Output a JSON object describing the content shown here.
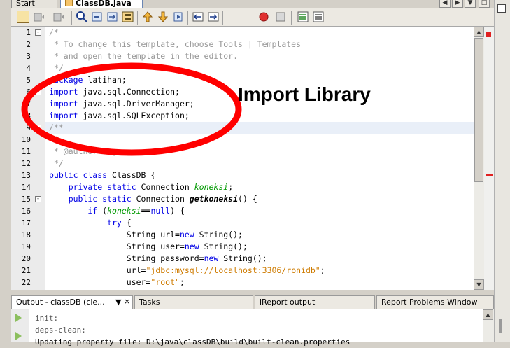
{
  "tabs": {
    "start_page": "Start Page",
    "active_tab": "ClassDB.java",
    "close_glyph": "×"
  },
  "toolbar": {
    "icons": [
      "new-file-icon",
      "history-back-icon",
      "history-forward-icon",
      "find-icon",
      "find-previous-icon",
      "find-next-icon",
      "toggle-highlight-icon",
      "previous-bookmark-icon",
      "next-bookmark-icon",
      "toggle-bookmark-icon",
      "shift-left-icon",
      "shift-right-icon",
      "start-macro-icon",
      "stop-macro-icon",
      "comment-icon",
      "uncomment-icon"
    ]
  },
  "editor": {
    "line_numbers": [
      "1",
      "2",
      "3",
      "4",
      "5",
      "6",
      "7",
      "8",
      "9",
      "10",
      "11",
      "12",
      "13",
      "14",
      "15",
      "16",
      "17",
      "18",
      "19",
      "20",
      "21",
      "22"
    ],
    "lines": {
      "l1": "/*",
      "l2": " * To change this template, choose Tools | Templates",
      "l3": " * and open the template in the editor.",
      "l4": " */",
      "l5_kw": "package",
      "l5_rest": " latihan;",
      "l6_kw": "import",
      "l6_rest": " java.sql.Connection;",
      "l7_kw": "import",
      "l7_rest": " java.sql.DriverManager;",
      "l8_kw": "import",
      "l8_rest": " java.sql.SQLException;",
      "l9": "/**",
      "l10": " *",
      "l11": " * @author bagong",
      "l12": " */",
      "l13_kw": "public class",
      "l13_rest": " ClassDB {",
      "l14_kw": "    private static",
      "l14_mid": " Connection ",
      "l14_fld": "koneksi",
      "l14_end": ";",
      "l15_kw": "    public static",
      "l15_mid": " Connection ",
      "l15_fn": "getkoneksi",
      "l15_end": "() {",
      "l16_kw": "        if",
      "l16_a": " (",
      "l16_fld": "koneksi",
      "l16_b": "==",
      "l16_null": "null",
      "l16_c": ") {",
      "l17_kw": "            try",
      "l17_rest": " {",
      "l18_a": "                String url=",
      "l18_kw": "new",
      "l18_b": " String();",
      "l19_a": "                String user=",
      "l19_kw": "new",
      "l19_b": " String();",
      "l20_a": "                String password=",
      "l20_kw": "new",
      "l20_b": " String();",
      "l21_a": "                url=",
      "l21_str": "\"jdbc:mysql://localhost:3306/ronidb\"",
      "l21_b": ";",
      "l22_a": "                user=",
      "l22_str": "\"root\"",
      "l22_b": ";"
    }
  },
  "annotation": {
    "text": "Import Library",
    "ellipse_color": "#ff0000"
  },
  "bottom_tabs": {
    "output": "Output - classDB (cle...",
    "tasks": "Tasks",
    "ireport": "iReport output",
    "report_problems": "Report Problems Window"
  },
  "output_lines": [
    "init:",
    "deps-clean:",
    "Updating property file: D:\\java\\classDB\\build\\built-clean.properties"
  ],
  "colors": {
    "keyword": "#0000e6",
    "comment": "#969696",
    "string": "#ce7b00",
    "field": "#009900"
  }
}
